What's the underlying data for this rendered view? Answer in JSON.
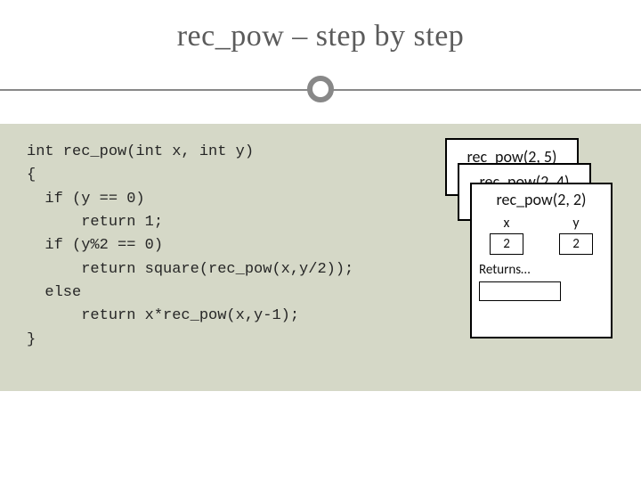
{
  "title": "rec_pow – step by step",
  "code": "int rec_pow(int x, int y)\n{\n  if (y == 0)\n      return 1;\n  if (y%2 == 0)\n      return square(rec_pow(x,y/2));\n  else\n      return x*rec_pow(x,y-1);\n}",
  "frames": {
    "f1": {
      "title": "rec_pow(2, 5)"
    },
    "f2": {
      "title": "rec_pow(2, 4)"
    },
    "f3": {
      "title": "rec_pow(2, 2)",
      "x_label": "x",
      "y_label": "y",
      "x_value": "2",
      "y_value": "2",
      "returns_label": "Returns…"
    }
  }
}
